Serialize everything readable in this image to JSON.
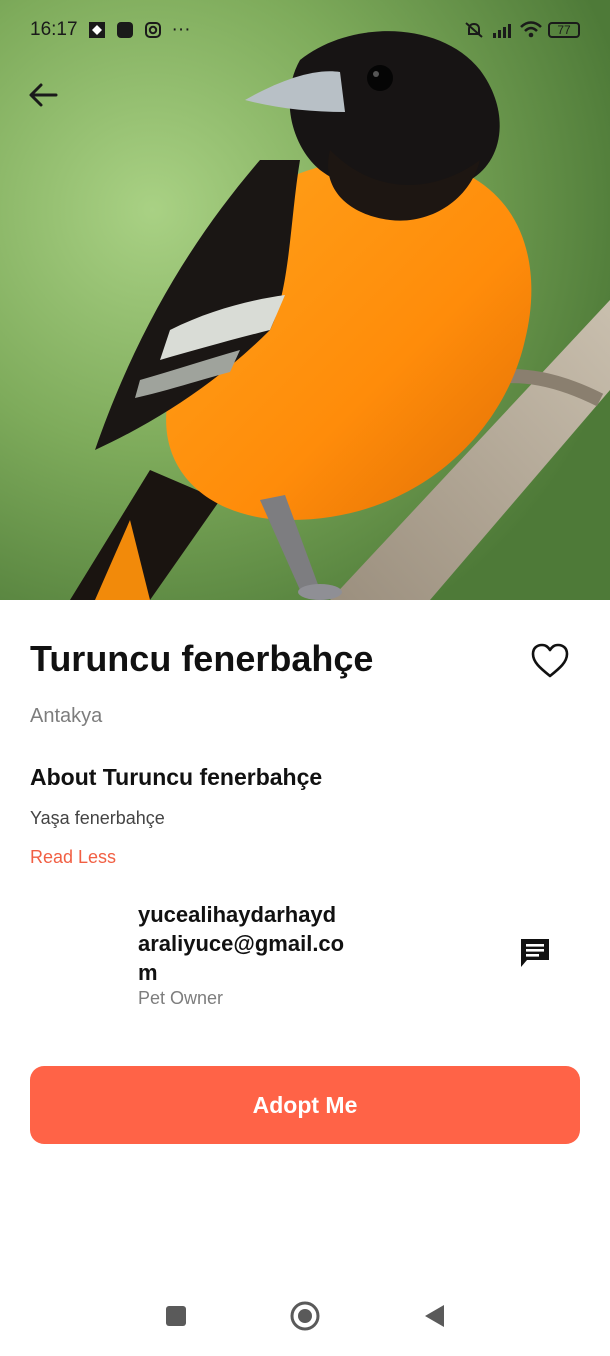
{
  "status_bar": {
    "time": "16:17",
    "left_icons": [
      "app-notification-icon",
      "square-app-icon",
      "instagram-icon",
      "more-dots-icon"
    ],
    "right_icons": [
      "mute-icon",
      "signal-icon",
      "wifi-icon",
      "battery-icon"
    ],
    "battery": "77",
    "more": "···"
  },
  "hero": {
    "icon": "bird-photo",
    "alt": "Orange and black bird perched on a branch"
  },
  "pet": {
    "name": "Turuncu fenerbahçe",
    "location": "Antakya",
    "favorite_icon": "heart-outline-icon"
  },
  "about": {
    "heading": "About Turuncu fenerbahçe",
    "text": "Yaşa fenerbahçe",
    "toggle_label": "Read Less"
  },
  "owner": {
    "email": "yucealihaydarhaydaraliyuce@gmail.com",
    "role": "Pet Owner",
    "message_icon": "message-icon"
  },
  "actions": {
    "adopt_label": "Adopt Me"
  },
  "colors": {
    "accent": "#ff6347",
    "link": "#f15f43",
    "muted_text": "#7d7d7d"
  },
  "nav_bar": {
    "icons": [
      "recent-apps-icon",
      "home-icon",
      "back-triangle-icon"
    ]
  }
}
